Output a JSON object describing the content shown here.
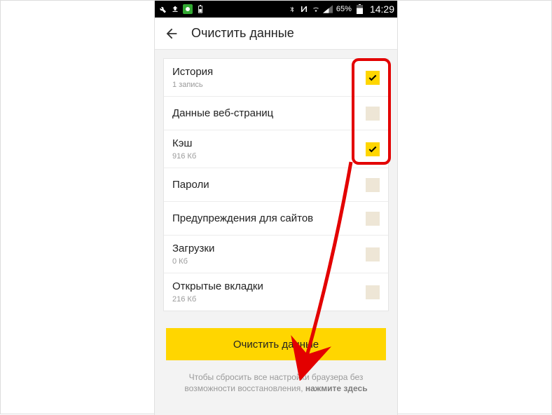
{
  "status": {
    "battery_pct": "65%",
    "time": "14:29"
  },
  "header": {
    "title": "Очистить данные"
  },
  "rows": [
    {
      "label": "История",
      "sub": "1 запись",
      "checked": true
    },
    {
      "label": "Данные веб-страниц",
      "sub": "",
      "checked": false
    },
    {
      "label": "Кэш",
      "sub": "916 Кб",
      "checked": true
    },
    {
      "label": "Пароли",
      "sub": "",
      "checked": false
    },
    {
      "label": "Предупреждения для сайтов",
      "sub": "",
      "checked": false
    },
    {
      "label": "Загрузки",
      "sub": "0 Кб",
      "checked": false
    },
    {
      "label": "Открытые вкладки",
      "sub": "216 Кб",
      "checked": false
    }
  ],
  "button": {
    "label": "Очистить данные"
  },
  "footer": {
    "line1": "Чтобы сбросить все настройки браузера без возможности восстановления, ",
    "bold": "нажмите здесь"
  }
}
